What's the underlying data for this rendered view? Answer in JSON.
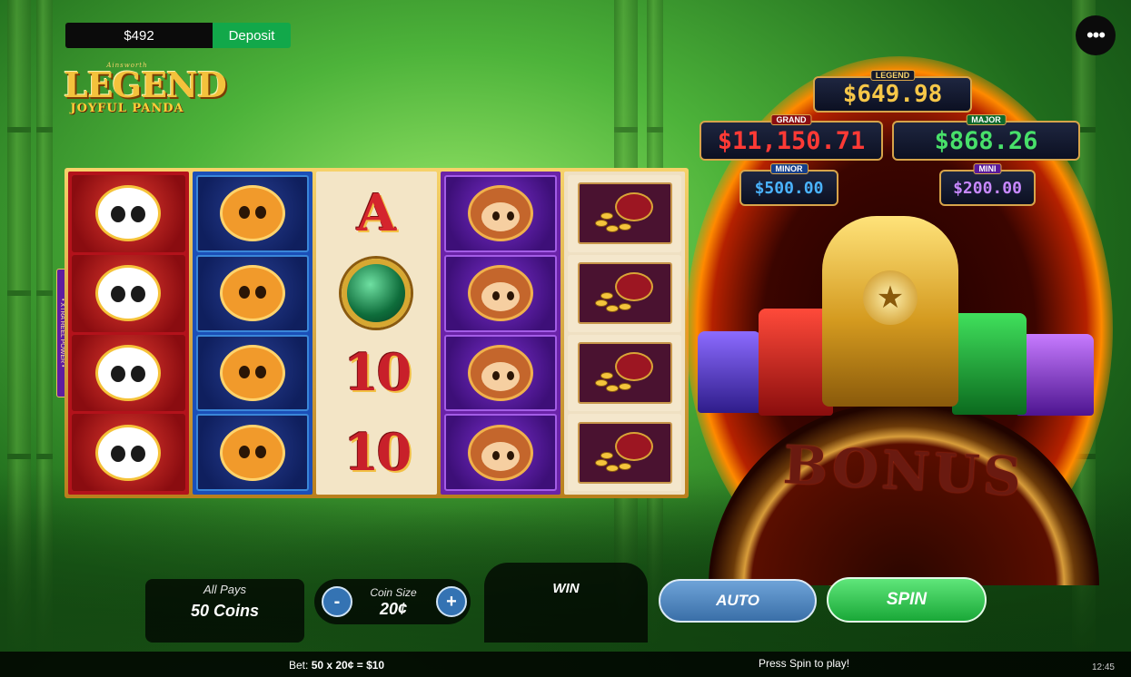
{
  "balance": "$492",
  "deposit_label": "Deposit",
  "menu_label": "•••",
  "logo": {
    "tagline": "Ainsworth",
    "title": "LEGEND",
    "subtitle": "JOYFUL PANDA"
  },
  "reels": {
    "side_tab": "• XTRA REEL POWER •",
    "reel3_symbols": [
      "A",
      "",
      "10",
      "10"
    ]
  },
  "jackpots": {
    "legend": {
      "label": "LEGEND",
      "value": "$649.98"
    },
    "grand": {
      "label": "GRAND",
      "value": "$11,150.71"
    },
    "major": {
      "label": "MAJOR",
      "value": "$868.26"
    },
    "minor": {
      "label": "MINOR",
      "value": "$500.00"
    },
    "mini": {
      "label": "MINI",
      "value": "$200.00"
    }
  },
  "bonus_label": "BONUS",
  "star_glyph": "★",
  "controls": {
    "all_pays_label": "All Pays",
    "all_pays_value": "50 Coins",
    "coin_size_label": "Coin Size",
    "coin_size_value": "20¢",
    "minus_label": "-",
    "plus_label": "+",
    "win_label": "WIN",
    "auto_label": "AUTO",
    "spin_label": "SPIN"
  },
  "status": {
    "bet_prefix": "Bet: ",
    "bet_value": "50 x 20¢ = $10",
    "message": "Press Spin to play!",
    "clock": "12:45"
  },
  "colors": {
    "deposit": "#12a84a",
    "spin": "#1aa838",
    "auto": "#3a6fa8",
    "grand": "#ff3a35",
    "major": "#48e06a",
    "minor": "#4ab3ff",
    "mini": "#c888ff",
    "legend": "#f6c748"
  }
}
